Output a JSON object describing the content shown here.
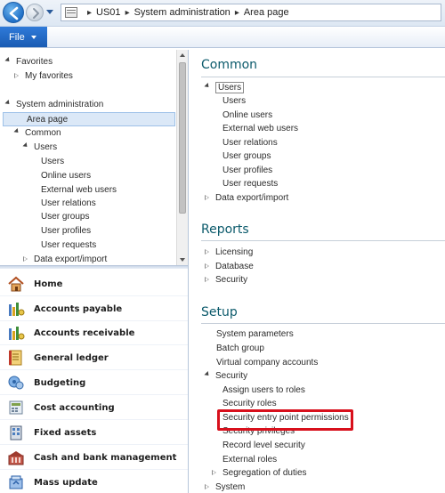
{
  "address": {
    "breadcrumbs": [
      "US01",
      "System administration",
      "Area page"
    ],
    "icon": "address-page-icon"
  },
  "ribbon": {
    "file_label": "File"
  },
  "nav_tree": {
    "items": [
      {
        "label": "Favorites",
        "state": "open"
      },
      {
        "label": "My favorites",
        "state": "closed"
      },
      {
        "label": "System administration",
        "state": "open"
      },
      {
        "label": "Area page",
        "state": "selected"
      },
      {
        "label": "Common",
        "state": "open"
      },
      {
        "label": "Users",
        "state": "open"
      },
      {
        "label": "Users"
      },
      {
        "label": "Online users"
      },
      {
        "label": "External web users"
      },
      {
        "label": "User relations"
      },
      {
        "label": "User groups"
      },
      {
        "label": "User profiles"
      },
      {
        "label": "User requests"
      },
      {
        "label": "Data export/import",
        "state": "closed"
      }
    ]
  },
  "modules": [
    {
      "label": "Home",
      "icon": "home-icon",
      "color": "#c0743a"
    },
    {
      "label": "Accounts payable",
      "icon": "accounts-payable-icon",
      "color": "#3f8f3a"
    },
    {
      "label": "Accounts receivable",
      "icon": "accounts-receivable-icon",
      "color": "#3f8f3a"
    },
    {
      "label": "General ledger",
      "icon": "general-ledger-icon",
      "color": "#c98a1f"
    },
    {
      "label": "Budgeting",
      "icon": "budgeting-icon",
      "color": "#4c83c4"
    },
    {
      "label": "Cost accounting",
      "icon": "cost-accounting-icon",
      "color": "#7a8fa6"
    },
    {
      "label": "Fixed assets",
      "icon": "fixed-assets-icon",
      "color": "#5b6f8a"
    },
    {
      "label": "Cash and bank management",
      "icon": "cash-bank-icon",
      "color": "#b0463a"
    },
    {
      "label": "Mass update",
      "icon": "mass-update-icon",
      "color": "#3d6fb6"
    }
  ],
  "content": {
    "common": {
      "title": "Common",
      "users_group": "Users",
      "users_items": [
        "Users",
        "Online users",
        "External web users",
        "User relations",
        "User groups",
        "User profiles",
        "User requests"
      ],
      "data_export": "Data export/import"
    },
    "reports": {
      "title": "Reports",
      "items": [
        "Licensing",
        "Database",
        "Security"
      ]
    },
    "setup": {
      "title": "Setup",
      "items": [
        "System parameters",
        "Batch group",
        "Virtual company accounts"
      ],
      "security_group": "Security",
      "security_items": [
        "Assign users to roles",
        "Security roles",
        "Security entry point permissions",
        "Security privileges",
        "Record level security",
        "External roles"
      ],
      "segregation": "Segregation of duties",
      "system": "System"
    }
  },
  "colors": {
    "section_title": "#0b5a6b",
    "highlight": "#d8101c",
    "file_button": "#1f63be"
  }
}
